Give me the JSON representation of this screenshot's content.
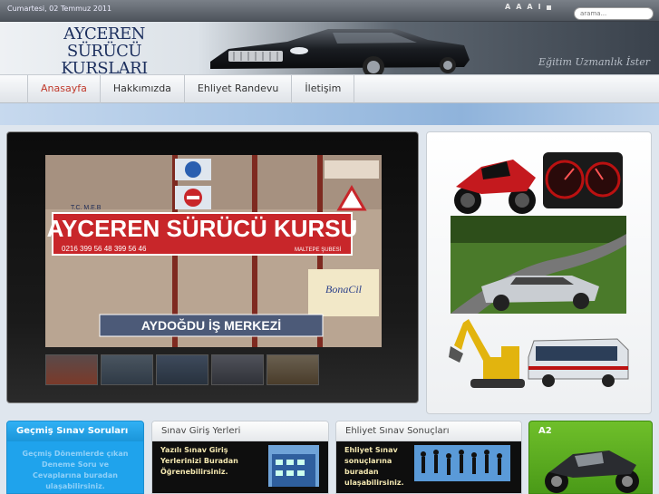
{
  "topbar": {
    "date": "Cumartesi, 02 Temmuz 2011",
    "font_controls": [
      "A",
      "A",
      "A",
      "I"
    ],
    "search_placeholder": "arama..."
  },
  "header": {
    "logo_line1": "AYCEREN SÜRÜCÜ",
    "logo_line2": "KURSLARI",
    "slogan": "Eğitim Uzmanlık İster"
  },
  "nav": {
    "items": [
      {
        "label": "Anasayfa"
      },
      {
        "label": "Hakkımızda"
      },
      {
        "label": "Ehliyet Randevu"
      },
      {
        "label": "İletişim"
      }
    ]
  },
  "slideshow": {
    "sign_main": "AYCEREN SÜRÜCÜ KURSU",
    "sign_small": "T.C. M.E.B",
    "sign_phone": "0216 399 56 48 399 56 46",
    "sign_branch": "MALTEPE ŞUBESİ",
    "sign_building": "AYDOĞDU İŞ MERKEZİ",
    "sign_bonacil": "BonaCil"
  },
  "modules": {
    "m1": {
      "title": "Geçmiş Sınav Soruları",
      "text": "Geçmiş Dönemlerde çıkan Deneme Soru ve Cevaplarına buradan ulaşabilirsiniz."
    },
    "m2": {
      "title": "Sınav Giriş Yerleri",
      "text_l1": "Yazılı Sınav Giriş",
      "text_l2": "Yerlerinizi Buradan",
      "text_l3": "Öğrenebilirsiniz."
    },
    "m3": {
      "title": "Ehliyet Sınav Sonuçları",
      "text_l1": "Ehliyet Sınav",
      "text_l2": "sonuçlarına",
      "text_l3": "buradan",
      "text_l4": "ulaşabilirsiniz."
    },
    "m4": {
      "title": "A2"
    }
  },
  "colors": {
    "accent_red": "#c0392b",
    "module_blue": "#1fa3ec",
    "module_green": "#5aab1f",
    "logo_navy": "#1c2f5e"
  }
}
